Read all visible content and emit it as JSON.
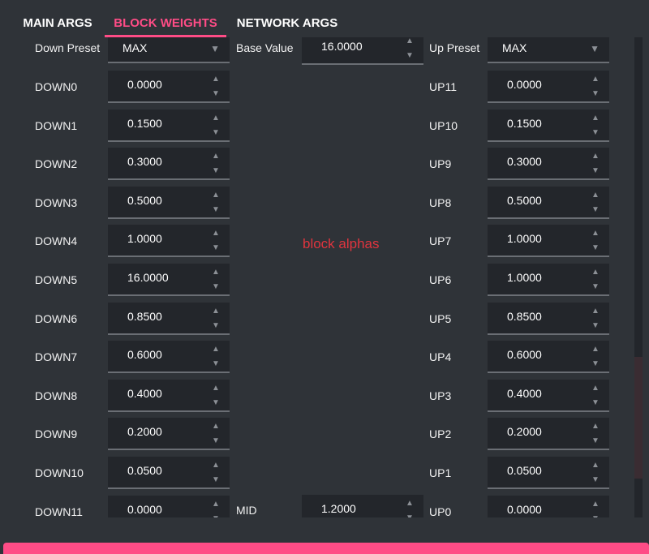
{
  "tabs": [
    {
      "label": "MAIN ARGS"
    },
    {
      "label": "BLOCK WEIGHTS"
    },
    {
      "label": "NETWORK ARGS"
    }
  ],
  "active_tab": "BLOCK WEIGHTS",
  "header_row": {
    "down_preset_label": "Down Preset",
    "down_preset_value": "MAX",
    "base_value_label": "Base Value",
    "base_value": "16.0000",
    "up_preset_label": "Up Preset",
    "up_preset_value": "MAX"
  },
  "overlay_text": "block alphas",
  "down": [
    {
      "label": "DOWN0",
      "value": "0.0000"
    },
    {
      "label": "DOWN1",
      "value": "0.1500"
    },
    {
      "label": "DOWN2",
      "value": "0.3000"
    },
    {
      "label": "DOWN3",
      "value": "0.5000"
    },
    {
      "label": "DOWN4",
      "value": "1.0000"
    },
    {
      "label": "DOWN5",
      "value": "16.0000"
    },
    {
      "label": "DOWN6",
      "value": "0.8500"
    },
    {
      "label": "DOWN7",
      "value": "0.6000"
    },
    {
      "label": "DOWN8",
      "value": "0.4000"
    },
    {
      "label": "DOWN9",
      "value": "0.2000"
    },
    {
      "label": "DOWN10",
      "value": "0.0500"
    },
    {
      "label": "DOWN11",
      "value": "0.0000"
    }
  ],
  "up": [
    {
      "label": "UP11",
      "value": "0.0000"
    },
    {
      "label": "UP10",
      "value": "0.1500"
    },
    {
      "label": "UP9",
      "value": "0.3000"
    },
    {
      "label": "UP8",
      "value": "0.5000"
    },
    {
      "label": "UP7",
      "value": "1.0000"
    },
    {
      "label": "UP6",
      "value": "1.0000"
    },
    {
      "label": "UP5",
      "value": "0.8500"
    },
    {
      "label": "UP4",
      "value": "0.6000"
    },
    {
      "label": "UP3",
      "value": "0.4000"
    },
    {
      "label": "UP2",
      "value": "0.2000"
    },
    {
      "label": "UP1",
      "value": "0.0500"
    },
    {
      "label": "UP0",
      "value": "0.0000"
    }
  ],
  "mid": {
    "label": "MID",
    "value": "1.2000"
  },
  "colors": {
    "accent": "#ff4c86",
    "overlay": "#e0343e",
    "background": "#2f3338",
    "field": "#23262b"
  },
  "icons": {
    "spin_up": "▲",
    "spin_down": "▼",
    "caret": "▼"
  }
}
